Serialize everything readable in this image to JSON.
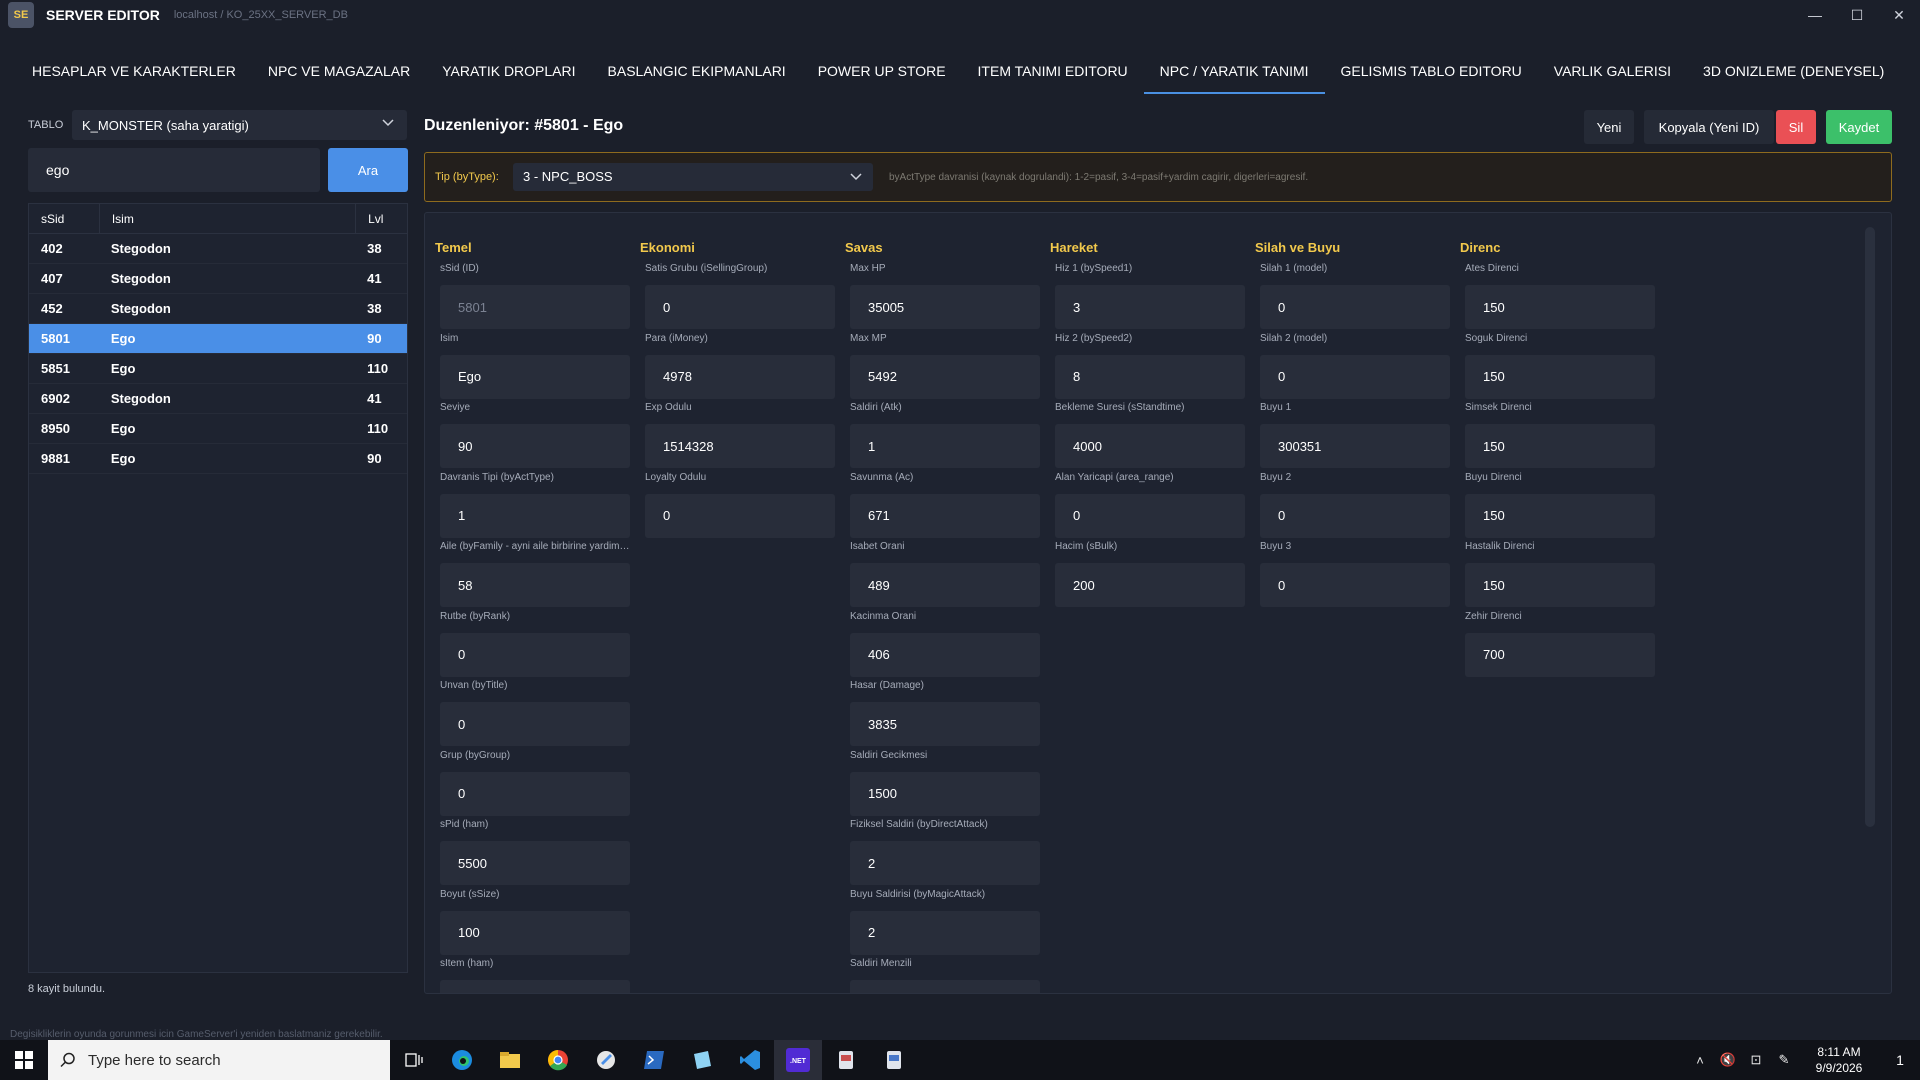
{
  "window": {
    "logo": "SE",
    "title": "SERVER EDITOR",
    "subtitle": "localhost / KO_25XX_SERVER_DB",
    "minimize_glyph": "—",
    "maximize_glyph": "☐",
    "close_glyph": "✕"
  },
  "tabs": [
    {
      "label": "HESAPLAR VE KARAKTERLER"
    },
    {
      "label": "NPC VE MAGAZALAR"
    },
    {
      "label": "YARATIK DROPLARI"
    },
    {
      "label": "BASLANGIC EKIPMANLARI"
    },
    {
      "label": "POWER UP STORE"
    },
    {
      "label": "ITEM TANIMI EDITORU"
    },
    {
      "label": "NPC / YARATIK TANIMI"
    },
    {
      "label": "GELISMIS TABLO EDITORU"
    },
    {
      "label": "VARLIK GALERISI"
    },
    {
      "label": "3D ONIZLEME (DENEYSEL)"
    }
  ],
  "left": {
    "table_label": "TABLO",
    "table_value": "K_MONSTER (saha yaratigi)",
    "search_value": "ego",
    "search_button": "Ara",
    "columns": {
      "sid": "sSid",
      "name": "Isim",
      "lvl": "Lvl"
    },
    "rows": [
      {
        "sid": "402",
        "name": "Stegodon",
        "lvl": "38"
      },
      {
        "sid": "407",
        "name": "Stegodon",
        "lvl": "41"
      },
      {
        "sid": "452",
        "name": "Stegodon",
        "lvl": "38"
      },
      {
        "sid": "5801",
        "name": "Ego",
        "lvl": "90"
      },
      {
        "sid": "5851",
        "name": "Ego",
        "lvl": "110"
      },
      {
        "sid": "6902",
        "name": "Stegodon",
        "lvl": "41"
      },
      {
        "sid": "8950",
        "name": "Ego",
        "lvl": "110"
      },
      {
        "sid": "9881",
        "name": "Ego",
        "lvl": "90"
      }
    ],
    "count_text": "8 kayit bulundu."
  },
  "editor": {
    "title": "Duzenleniyor: #5801 - Ego",
    "btn_new": "Yeni",
    "btn_copy": "Kopyala (Yeni ID)",
    "btn_delete": "Sil",
    "btn_save": "Kaydet",
    "type_label": "Tip (byType):",
    "type_value": "3 - NPC_BOSS",
    "type_hint": "byActType davranisi (kaynak dogrulandi): 1-2=pasif, 3-4=pasif+yardim cagirir, digerleri=agresif."
  },
  "columns": [
    {
      "title": "Temel",
      "fields": [
        {
          "label": "sSid (ID)",
          "value": "5801"
        },
        {
          "label": "Isim",
          "value": "Ego"
        },
        {
          "label": "Seviye",
          "value": "90"
        },
        {
          "label": "Davranis Tipi (byActType)",
          "value": "1"
        },
        {
          "label": "Aile (byFamily - ayni aile birbirine yardim eder)",
          "value": "58"
        },
        {
          "label": "Rutbe (byRank)",
          "value": "0"
        },
        {
          "label": "Unvan (byTitle)",
          "value": "0"
        },
        {
          "label": "Grup (byGroup)",
          "value": "0"
        },
        {
          "label": "sPid (ham)",
          "value": "5500"
        },
        {
          "label": "Boyut (sSize)",
          "value": "100"
        },
        {
          "label": "sItem (ham)",
          "value": ""
        }
      ]
    },
    {
      "title": "Ekonomi",
      "fields": [
        {
          "label": "Satis Grubu (iSellingGroup)",
          "value": "0"
        },
        {
          "label": "Para (iMoney)",
          "value": "4978"
        },
        {
          "label": "Exp Odulu",
          "value": "1514328"
        },
        {
          "label": "Loyalty Odulu",
          "value": "0"
        }
      ]
    },
    {
      "title": "Savas",
      "fields": [
        {
          "label": "Max HP",
          "value": "35005"
        },
        {
          "label": "Max MP",
          "value": "5492"
        },
        {
          "label": "Saldiri (Atk)",
          "value": "1"
        },
        {
          "label": "Savunma (Ac)",
          "value": "671"
        },
        {
          "label": "Isabet Orani",
          "value": "489"
        },
        {
          "label": "Kacinma Orani",
          "value": "406"
        },
        {
          "label": "Hasar (Damage)",
          "value": "3835"
        },
        {
          "label": "Saldiri Gecikmesi",
          "value": "1500"
        },
        {
          "label": "Fiziksel Saldiri (byDirectAttack)",
          "value": "2"
        },
        {
          "label": "Buyu Saldirisi (byMagicAttack)",
          "value": "2"
        },
        {
          "label": "Saldiri Menzili",
          "value": ""
        }
      ]
    },
    {
      "title": "Hareket",
      "fields": [
        {
          "label": "Hiz 1 (bySpeed1)",
          "value": "3"
        },
        {
          "label": "Hiz 2 (bySpeed2)",
          "value": "8"
        },
        {
          "label": "Bekleme Suresi (sStandtime)",
          "value": "4000"
        },
        {
          "label": "Alan Yaricapi (area_range)",
          "value": "0"
        },
        {
          "label": "Hacim (sBulk)",
          "value": "200"
        }
      ]
    },
    {
      "title": "Silah ve Buyu",
      "fields": [
        {
          "label": "Silah 1 (model)",
          "value": "0"
        },
        {
          "label": "Silah 2 (model)",
          "value": "0"
        },
        {
          "label": "Buyu 1",
          "value": "300351"
        },
        {
          "label": "Buyu 2",
          "value": "0"
        },
        {
          "label": "Buyu 3",
          "value": "0"
        }
      ]
    },
    {
      "title": "Direnc",
      "fields": [
        {
          "label": "Ates Direnci",
          "value": "150"
        },
        {
          "label": "Soguk Direnci",
          "value": "150"
        },
        {
          "label": "Simsek Direnci",
          "value": "150"
        },
        {
          "label": "Buyu Direnci",
          "value": "150"
        },
        {
          "label": "Hastalik Direnci",
          "value": "150"
        },
        {
          "label": "Zehir Direnci",
          "value": "700"
        }
      ]
    }
  ],
  "status_hint": "Degisikliklerin oyunda gorunmesi icin GameServer'i yeniden baslatmaniz gerekebilir.",
  "taskbar": {
    "search_placeholder": "Type here to search",
    "time": "8:11 AM",
    "date": "9/9/2026",
    "notification_count": "1",
    "dotnet_label": ".NET"
  },
  "colors": {
    "accent": "#4a8fe7",
    "section_title": "#f2c94c",
    "delete": "#ea5055",
    "save": "#3cc06a"
  }
}
